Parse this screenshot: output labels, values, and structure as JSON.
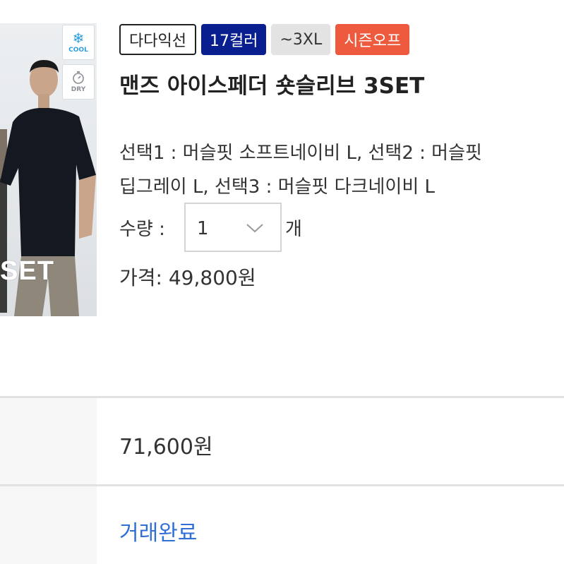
{
  "product": {
    "tags": [
      "다다익선",
      "17컬러",
      "~3XL",
      "시즌오프"
    ],
    "tag_colors": [
      "#ffffff",
      "#0a1f8f",
      "#e3e3e3",
      "#ee5a3d"
    ],
    "title": "맨즈 아이스페더 숏슬리브 3SET",
    "options_line1": "선택1 : 머슬핏 소프트네이비 L, 선택2 : 머슬핏",
    "options_line2": "딥그레이 L, 선택3 : 머슬핏 다크네이비 L",
    "quantity_label": "수량 :",
    "quantity_value": "1",
    "quantity_unit": "개",
    "price_text": "가격: 49,800원"
  },
  "thumbnail": {
    "badges": [
      {
        "icon": "snowflake-icon",
        "label": "COOL",
        "color": "#2b9de0"
      },
      {
        "icon": "stopwatch-icon",
        "label": "DRY",
        "color": "#8a8f96"
      }
    ],
    "overlay_text": "SET"
  },
  "summary": {
    "original_price": "71,600원",
    "status": "거래완료",
    "status_color": "#2f6fd6"
  }
}
